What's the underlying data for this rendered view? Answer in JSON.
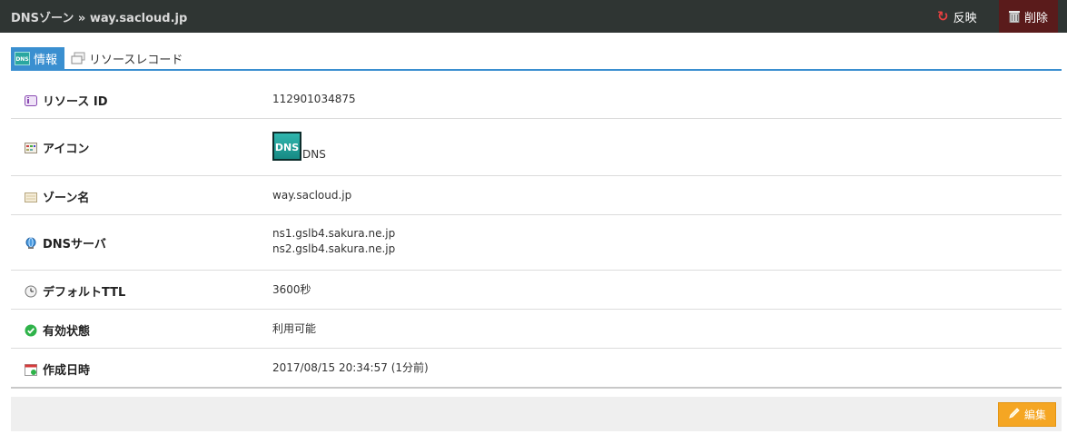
{
  "header": {
    "breadcrumb": "DNSゾーン » way.sacloud.jp",
    "reflect_label": "反映",
    "delete_label": "削除",
    "colors": {
      "bar": "#2f3533",
      "delete_bg": "#5a1b1b",
      "reflect_icon": "#e64040"
    }
  },
  "tabs": [
    {
      "label": "情報",
      "icon": "dns-badge-icon",
      "active": true
    },
    {
      "label": "リソースレコード",
      "icon": "records-icon",
      "active": false
    }
  ],
  "info": {
    "resource_id": {
      "label": "リソース ID",
      "value": "112901034875",
      "icon": "id-card-icon"
    },
    "icon": {
      "label": "アイコン",
      "value": "DNS",
      "logo_text": "DNS",
      "icon": "icon-grid-icon"
    },
    "zone_name": {
      "label": "ゾーン名",
      "value": "way.sacloud.jp",
      "icon": "zone-box-icon"
    },
    "dns_servers": {
      "label": "DNSサーバ",
      "values": [
        "ns1.gslb4.sakura.ne.jp",
        "ns2.gslb4.sakura.ne.jp"
      ],
      "icon": "globe-icon"
    },
    "default_ttl": {
      "label": "デフォルトTTL",
      "value": "3600秒",
      "icon": "clock-icon"
    },
    "status": {
      "label": "有効状態",
      "value": "利用可能",
      "icon": "check-circle-icon"
    },
    "created_at": {
      "label": "作成日時",
      "value": "2017/08/15 20:34:57 (1分前)",
      "icon": "calendar-icon"
    }
  },
  "footer": {
    "edit_label": "編集",
    "colors": {
      "edit_bg": "#f5a623"
    }
  }
}
